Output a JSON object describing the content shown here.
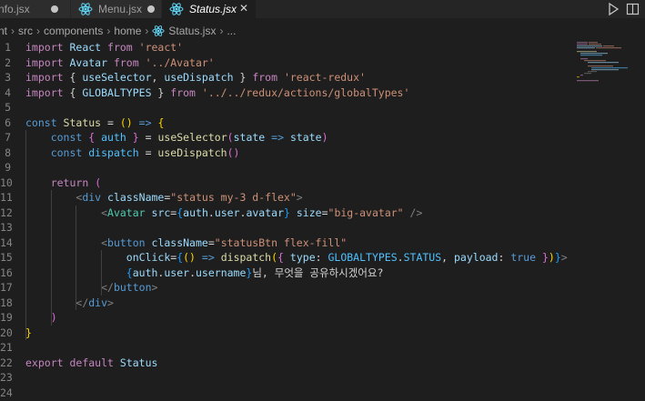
{
  "tabs": [
    {
      "label": "nfo.jsx",
      "state": "dirty"
    },
    {
      "label": "Menu.jsx",
      "state": "dirty"
    },
    {
      "label": "Status.jsx",
      "state": "active"
    }
  ],
  "icons": {
    "tab_file": "react-icon",
    "close": "close-icon",
    "run": "play-icon",
    "split": "split-editor-icon"
  },
  "breadcrumb": [
    "nt",
    "src",
    "components",
    "home",
    "Status.jsx",
    "..."
  ],
  "line_numbers": [
    "1",
    "2",
    "3",
    "4",
    "5",
    "6",
    "7",
    "8",
    "9",
    "10",
    "11",
    "12",
    "13",
    "14",
    "15",
    "16",
    "17",
    "18",
    "19",
    "20",
    "21",
    "22",
    "23",
    "24"
  ],
  "code_lines": [
    [
      {
        "t": "import",
        "c": "imp"
      },
      {
        "t": " React ",
        "c": "var"
      },
      {
        "t": "from",
        "c": "imp"
      },
      {
        "t": " 'react'",
        "c": "str"
      }
    ],
    [
      {
        "t": "import",
        "c": "imp"
      },
      {
        "t": " Avatar ",
        "c": "var"
      },
      {
        "t": "from",
        "c": "imp"
      },
      {
        "t": " '../Avatar'",
        "c": "str"
      }
    ],
    [
      {
        "t": "import",
        "c": "imp"
      },
      {
        "t": " { ",
        "c": "txt"
      },
      {
        "t": "useSelector",
        "c": "var"
      },
      {
        "t": ", ",
        "c": "txt"
      },
      {
        "t": "useDispatch",
        "c": "var"
      },
      {
        "t": " } ",
        "c": "txt"
      },
      {
        "t": "from",
        "c": "imp"
      },
      {
        "t": " 'react-redux'",
        "c": "str"
      }
    ],
    [
      {
        "t": "import",
        "c": "imp"
      },
      {
        "t": " { ",
        "c": "txt"
      },
      {
        "t": "GLOBALTYPES",
        "c": "var"
      },
      {
        "t": " } ",
        "c": "txt"
      },
      {
        "t": "from",
        "c": "imp"
      },
      {
        "t": " '../../redux/actions/globalTypes'",
        "c": "str"
      }
    ],
    [],
    [
      {
        "t": "const ",
        "c": "kw"
      },
      {
        "t": "Status",
        "c": "fn"
      },
      {
        "t": " = ",
        "c": "txt"
      },
      {
        "t": "()",
        "c": "br1"
      },
      {
        "t": " ",
        "c": "txt"
      },
      {
        "t": "=>",
        "c": "kw"
      },
      {
        "t": " ",
        "c": "txt"
      },
      {
        "t": "{",
        "c": "br1"
      }
    ],
    [
      {
        "t": "    ",
        "c": "txt"
      },
      {
        "t": "const ",
        "c": "kw"
      },
      {
        "t": "{",
        "c": "br2"
      },
      {
        "t": " ",
        "c": "txt"
      },
      {
        "t": "auth",
        "c": "cons"
      },
      {
        "t": " ",
        "c": "txt"
      },
      {
        "t": "}",
        "c": "br2"
      },
      {
        "t": " = ",
        "c": "txt"
      },
      {
        "t": "useSelector",
        "c": "fn"
      },
      {
        "t": "(",
        "c": "br2"
      },
      {
        "t": "state",
        "c": "var"
      },
      {
        "t": " ",
        "c": "txt"
      },
      {
        "t": "=>",
        "c": "kw"
      },
      {
        "t": " ",
        "c": "txt"
      },
      {
        "t": "state",
        "c": "var"
      },
      {
        "t": ")",
        "c": "br2"
      }
    ],
    [
      {
        "t": "    ",
        "c": "txt"
      },
      {
        "t": "const ",
        "c": "kw"
      },
      {
        "t": "dispatch",
        "c": "cons"
      },
      {
        "t": " = ",
        "c": "txt"
      },
      {
        "t": "useDispatch",
        "c": "fn"
      },
      {
        "t": "()",
        "c": "br2"
      }
    ],
    [],
    [
      {
        "t": "    ",
        "c": "txt"
      },
      {
        "t": "return",
        "c": "imp"
      },
      {
        "t": " ",
        "c": "txt"
      },
      {
        "t": "(",
        "c": "br2"
      }
    ],
    [
      {
        "t": "        ",
        "c": "txt"
      },
      {
        "t": "<",
        "c": "tag"
      },
      {
        "t": "div",
        "c": "html"
      },
      {
        "t": " ",
        "c": "txt"
      },
      {
        "t": "className",
        "c": "attr"
      },
      {
        "t": "=",
        "c": "txt"
      },
      {
        "t": "\"status my-3 d-flex\"",
        "c": "str"
      },
      {
        "t": ">",
        "c": "tag"
      }
    ],
    [
      {
        "t": "            ",
        "c": "txt"
      },
      {
        "t": "<",
        "c": "tag"
      },
      {
        "t": "Avatar",
        "c": "cmp"
      },
      {
        "t": " ",
        "c": "txt"
      },
      {
        "t": "src",
        "c": "attr"
      },
      {
        "t": "=",
        "c": "txt"
      },
      {
        "t": "{",
        "c": "br3"
      },
      {
        "t": "auth",
        "c": "var"
      },
      {
        "t": ".",
        "c": "txt"
      },
      {
        "t": "user",
        "c": "var"
      },
      {
        "t": ".",
        "c": "txt"
      },
      {
        "t": "avatar",
        "c": "var"
      },
      {
        "t": "}",
        "c": "br3"
      },
      {
        "t": " ",
        "c": "txt"
      },
      {
        "t": "size",
        "c": "attr"
      },
      {
        "t": "=",
        "c": "txt"
      },
      {
        "t": "\"big-avatar\"",
        "c": "str"
      },
      {
        "t": " />",
        "c": "tag"
      }
    ],
    [],
    [
      {
        "t": "            ",
        "c": "txt"
      },
      {
        "t": "<",
        "c": "tag"
      },
      {
        "t": "button",
        "c": "html"
      },
      {
        "t": " ",
        "c": "txt"
      },
      {
        "t": "className",
        "c": "attr"
      },
      {
        "t": "=",
        "c": "txt"
      },
      {
        "t": "\"statusBtn flex-fill\"",
        "c": "str"
      }
    ],
    [
      {
        "t": "                ",
        "c": "txt"
      },
      {
        "t": "onClick",
        "c": "attr"
      },
      {
        "t": "=",
        "c": "txt"
      },
      {
        "t": "{",
        "c": "br3"
      },
      {
        "t": "()",
        "c": "br1"
      },
      {
        "t": " ",
        "c": "txt"
      },
      {
        "t": "=>",
        "c": "kw"
      },
      {
        "t": " ",
        "c": "txt"
      },
      {
        "t": "dispatch",
        "c": "fn"
      },
      {
        "t": "(",
        "c": "br1"
      },
      {
        "t": "{",
        "c": "br2"
      },
      {
        "t": " ",
        "c": "txt"
      },
      {
        "t": "type",
        "c": "var"
      },
      {
        "t": ": ",
        "c": "txt"
      },
      {
        "t": "GLOBALTYPES",
        "c": "cons"
      },
      {
        "t": ".",
        "c": "txt"
      },
      {
        "t": "STATUS",
        "c": "cons"
      },
      {
        "t": ", ",
        "c": "txt"
      },
      {
        "t": "payload",
        "c": "var"
      },
      {
        "t": ": ",
        "c": "txt"
      },
      {
        "t": "true",
        "c": "kw"
      },
      {
        "t": " ",
        "c": "txt"
      },
      {
        "t": "}",
        "c": "br2"
      },
      {
        "t": ")",
        "c": "br1"
      },
      {
        "t": "}",
        "c": "br3"
      },
      {
        "t": ">",
        "c": "tag"
      }
    ],
    [
      {
        "t": "                ",
        "c": "txt"
      },
      {
        "t": "{",
        "c": "br3"
      },
      {
        "t": "auth",
        "c": "var"
      },
      {
        "t": ".",
        "c": "txt"
      },
      {
        "t": "user",
        "c": "var"
      },
      {
        "t": ".",
        "c": "txt"
      },
      {
        "t": "username",
        "c": "var"
      },
      {
        "t": "}",
        "c": "br3"
      },
      {
        "t": "님, 무엇을 공유하시겠어요?",
        "c": "txt"
      }
    ],
    [
      {
        "t": "            ",
        "c": "txt"
      },
      {
        "t": "</",
        "c": "tag"
      },
      {
        "t": "button",
        "c": "html"
      },
      {
        "t": ">",
        "c": "tag"
      }
    ],
    [
      {
        "t": "        ",
        "c": "txt"
      },
      {
        "t": "</",
        "c": "tag"
      },
      {
        "t": "div",
        "c": "html"
      },
      {
        "t": ">",
        "c": "tag"
      }
    ],
    [
      {
        "t": "    ",
        "c": "txt"
      },
      {
        "t": ")",
        "c": "br2"
      }
    ],
    [
      {
        "t": "}",
        "c": "br1"
      }
    ],
    [],
    [
      {
        "t": "export",
        "c": "imp"
      },
      {
        "t": " ",
        "c": "txt"
      },
      {
        "t": "default",
        "c": "imp"
      },
      {
        "t": " ",
        "c": "txt"
      },
      {
        "t": "Status",
        "c": "var"
      }
    ],
    [],
    []
  ],
  "colors": {
    "editor_bg": "#1e1e1e",
    "tabbar_bg": "#252526",
    "react_icon": "#61dafb"
  }
}
